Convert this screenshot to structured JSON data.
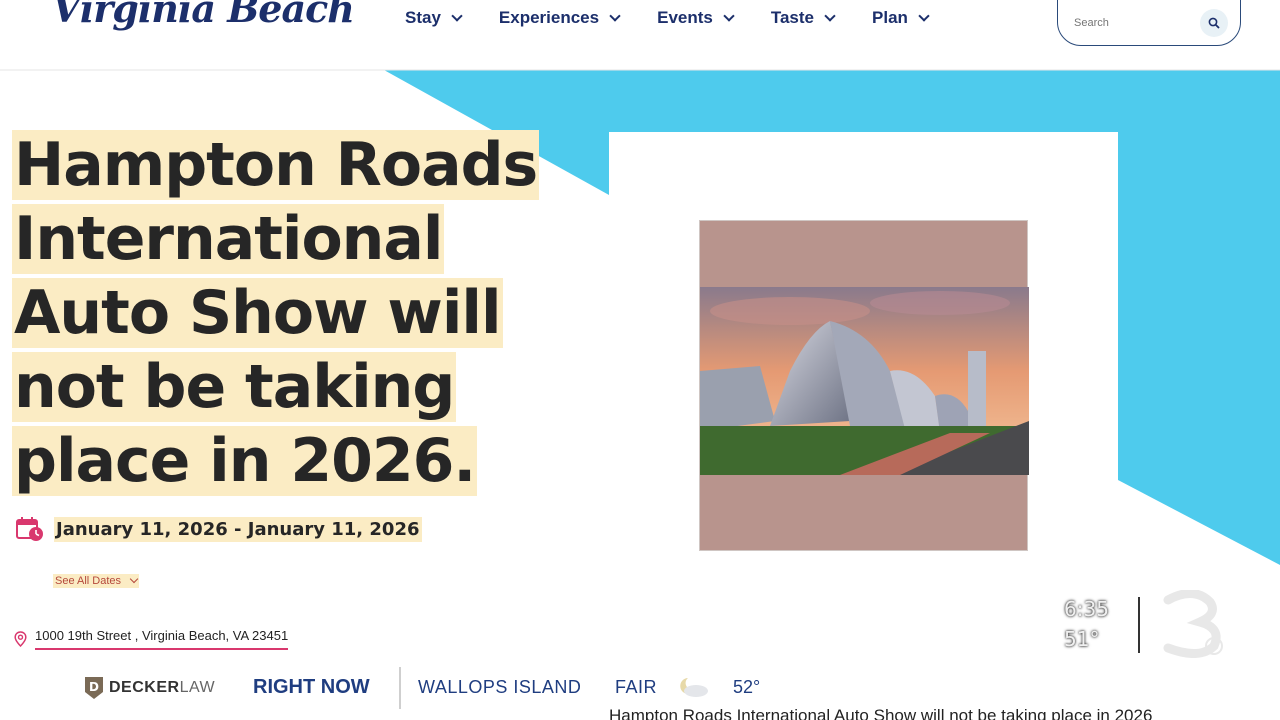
{
  "header": {
    "logo_text": "Virginia Beach",
    "nav": [
      {
        "label": "Stay"
      },
      {
        "label": "Experiences"
      },
      {
        "label": "Events"
      },
      {
        "label": "Taste"
      },
      {
        "label": "Plan"
      }
    ],
    "search_placeholder": "Search",
    "search_icon": "search-icon"
  },
  "event": {
    "title_lines": [
      "Hampton Roads",
      "International",
      "Auto Show will",
      "not be taking",
      "place in 2026."
    ],
    "date_range": "January 11, 2026 - January 11, 2026",
    "date_icon": "calendar-clock-icon",
    "see_all_dates": "See All Dates",
    "address": "1000 19th Street , Virginia Beach, VA 23451",
    "address_icon": "location-pin-icon"
  },
  "tv_overlay": {
    "time": "6:35",
    "temperature": "51°",
    "sponsor_brand": "DECKER",
    "sponsor_suffix": "LAW",
    "segment": "RIGHT NOW",
    "weather_location": "WALLOPS ISLAND",
    "weather_condition": "FAIR",
    "weather_temp": "52°",
    "weather_icon": "partly-cloudy-night-icon",
    "crawl_text": "Hampton Roads International Auto Show will not be taking place in 2026"
  },
  "colors": {
    "brand_navy": "#1c2f6b",
    "accent_cyan": "#4ecbed",
    "highlight": "#fbecc4",
    "pink_accent": "#d9386e",
    "ticker_blue": "#1f3d80"
  }
}
